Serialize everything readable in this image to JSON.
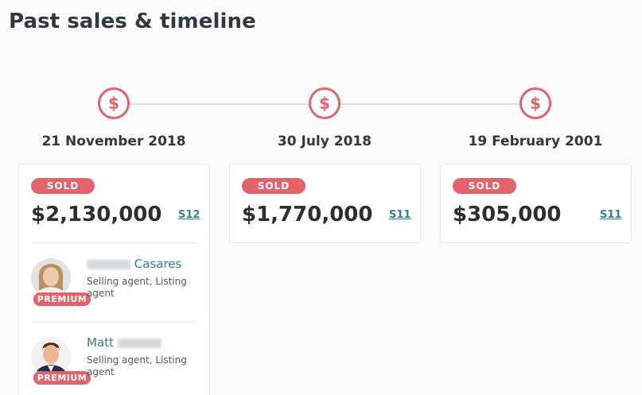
{
  "page": {
    "title": "Past sales & timeline"
  },
  "sales": [
    {
      "date": "21 November 2018",
      "badge": "SOLD",
      "price": "$2,130,000",
      "source": "S12",
      "agents": [
        {
          "name": "Casares",
          "role": "Selling agent, Listing agent",
          "badge": "PREMIUM"
        },
        {
          "name": "Matt",
          "role": "Selling agent, Listing agent",
          "badge": "PREMIUM"
        }
      ]
    },
    {
      "date": "30 July 2018",
      "badge": "SOLD",
      "price": "$1,770,000",
      "source": "S11"
    },
    {
      "date": "19 February 2001",
      "badge": "SOLD",
      "price": "$305,000",
      "source": "S11"
    }
  ],
  "icons": {
    "timeline_marker": "dollar-icon"
  },
  "colors": {
    "accent": "#e3636b",
    "link": "#3a7e88",
    "line": "#dadcdf"
  }
}
